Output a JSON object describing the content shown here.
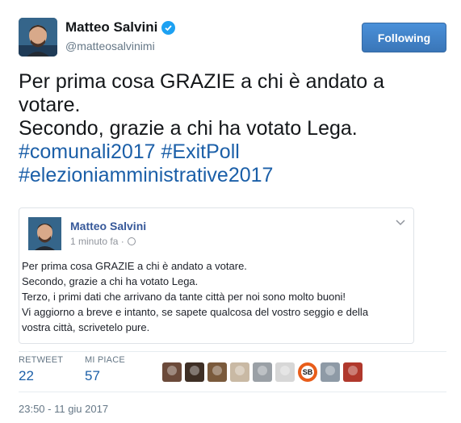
{
  "author": {
    "display_name": "Matteo Salvini",
    "handle": "@matteosalvinimi",
    "follow_label": "Following"
  },
  "tweet": {
    "lines": [
      "Per prima cosa GRAZIE a chi è andato a",
      "votare.",
      "Secondo, grazie a chi ha votato Lega."
    ],
    "hashtags_line1": [
      "#comunali2017",
      "#ExitPoll"
    ],
    "hashtags_line2": "#elezioniamministrative2017"
  },
  "embed": {
    "name": "Matteo Salvini",
    "time": "1 minuto fa ·",
    "lines": [
      "Per prima cosa GRAZIE a chi è andato a votare.",
      "Secondo, grazie a chi ha votato Lega.",
      "Terzo, i primi dati che arrivano da tante città per noi sono molto buoni!",
      "Vi aggiorno a breve e intanto, se sapete qualcosa del vostro seggio e della",
      "vostra città, scrivetelo pure."
    ]
  },
  "stats": {
    "retweet_label": "RETWEET",
    "retweet_count": "22",
    "like_label": "MI PIACE",
    "like_count": "57"
  },
  "likers": [
    {
      "color": "#6b4a3a"
    },
    {
      "color": "#3e2f25"
    },
    {
      "color": "#7a5a3c"
    },
    {
      "color": "#c9b9a4"
    },
    {
      "color": "#9aa0a6"
    },
    {
      "color": "#d7d7d7"
    },
    {
      "color": "#e85d1a",
      "initials": "SB"
    },
    {
      "color": "#8e9aa6"
    },
    {
      "color": "#b0382c"
    }
  ],
  "timestamp": "23:50 - 11 giu 2017",
  "colors": {
    "link": "#1b5fa8",
    "follow_button": "#3b7bbf",
    "verified": "#1da1f2",
    "facebook_name": "#365899"
  }
}
